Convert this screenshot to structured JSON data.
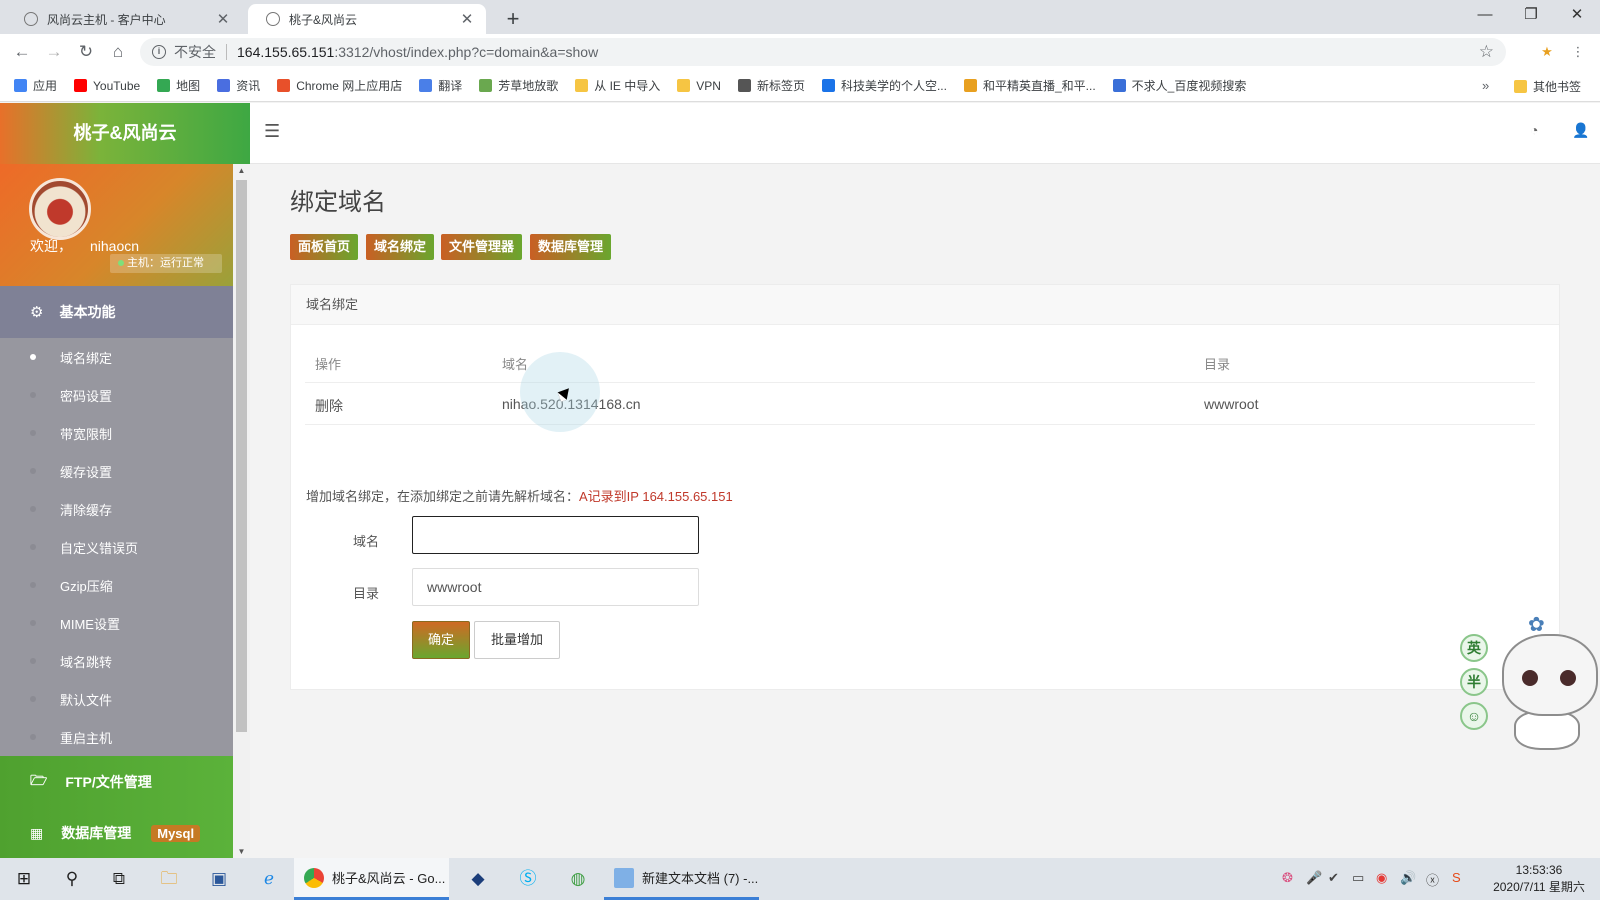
{
  "browser": {
    "tabs": [
      {
        "title": "风尚云主机 - 客户中心",
        "active": false
      },
      {
        "title": "桃子&风尚云",
        "active": true
      }
    ],
    "security_label": "不安全",
    "url_host": "164.155.65.151",
    "url_path": ":3312/vhost/index.php?c=domain&a=show",
    "bookmarks": [
      "应用",
      "YouTube",
      "地图",
      "资讯",
      "Chrome 网上应用店",
      "翻译",
      "芳草地放歌",
      "从 IE 中导入",
      "VPN",
      "新标签页",
      "科技美学的个人空...",
      "和平精英直播_和平...",
      "不求人_百度视频搜索"
    ],
    "bookmark_colors": [
      "#4285f4",
      "#ff0000",
      "#34a853",
      "#4a6ee0",
      "#e8502a",
      "#4a7fe8",
      "#6aa84f",
      "#f6c543",
      "#f6c543",
      "#555555",
      "#1a73e8",
      "#e8a020",
      "#3a6fd8"
    ],
    "other_bookmarks": "其他书签"
  },
  "app": {
    "logo": "桃子&风尚云",
    "welcome": "欢迎，",
    "username": "nihaocn",
    "host_status": "主机：运行正常",
    "section_basic": "基本功能",
    "menu": [
      {
        "label": "域名绑定",
        "active": true
      },
      {
        "label": "密码设置",
        "active": false
      },
      {
        "label": "带宽限制",
        "active": false
      },
      {
        "label": "缓存设置",
        "active": false
      },
      {
        "label": "清除缓存",
        "active": false
      },
      {
        "label": "自定义错误页",
        "active": false
      },
      {
        "label": "Gzip压缩",
        "active": false
      },
      {
        "label": "MIME设置",
        "active": false
      },
      {
        "label": "域名跳转",
        "active": false
      },
      {
        "label": "默认文件",
        "active": false
      },
      {
        "label": "重启主机",
        "active": false
      }
    ],
    "section_ftp": "FTP/文件管理",
    "section_db": "数据库管理",
    "db_badge": "Mysql"
  },
  "main": {
    "title": "绑定域名",
    "quick_buttons": [
      "面板首页",
      "域名绑定",
      "文件管理器",
      "数据库管理"
    ],
    "panel_title": "域名绑定",
    "table": {
      "headers": [
        "操作",
        "域名",
        "目录"
      ],
      "rows": [
        {
          "action": "删除",
          "domain": "nihao.520.1314168.cn",
          "dir": "wwwroot"
        }
      ]
    },
    "hint_text": "增加域名绑定，在添加绑定之前请先解析域名：",
    "hint_highlight": "A记录到IP 164.155.65.151",
    "form": {
      "domain_label": "域名",
      "domain_value": "",
      "dir_label": "目录",
      "dir_value": "wwwroot",
      "submit_label": "确定",
      "batch_label": "批量增加"
    }
  },
  "ime": [
    "英",
    "半",
    "☺"
  ],
  "taskbar": {
    "tasks": [
      "桃子&风尚云 - Go...",
      "新建文本文档 (7) -..."
    ],
    "time": "13:53:36",
    "date": "2020/7/11 星期六"
  }
}
